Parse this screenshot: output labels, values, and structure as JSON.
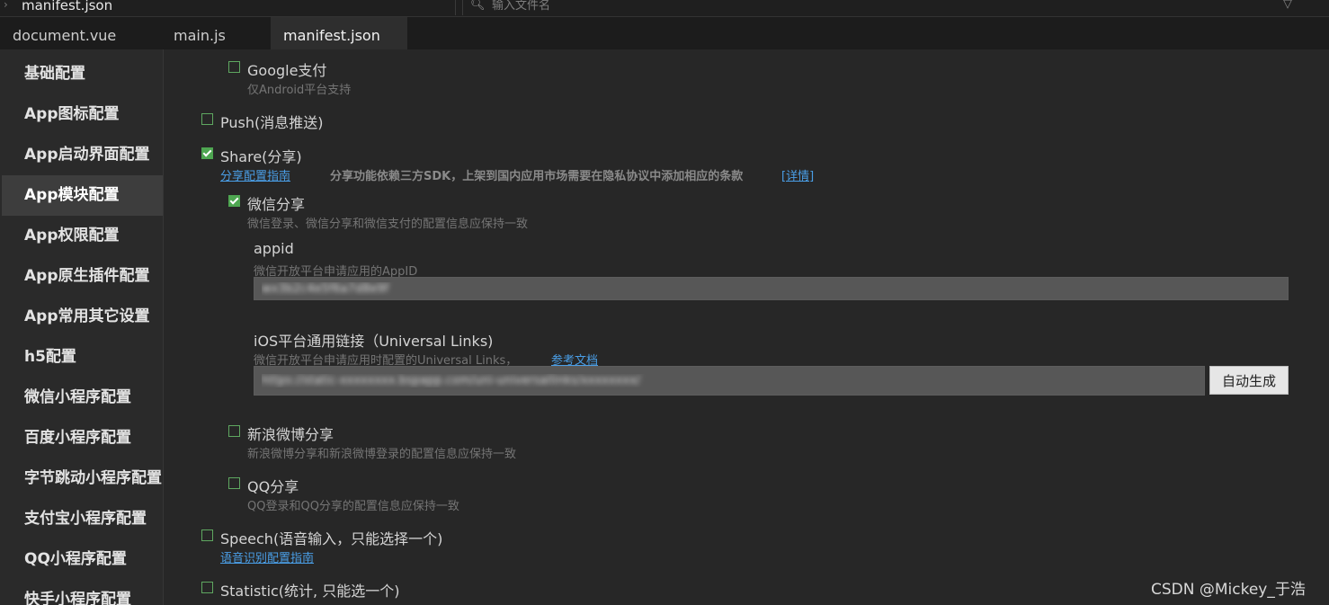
{
  "breadcrumb": {
    "file": "manifest.json"
  },
  "file_search": {
    "placeholder": "输入文件名"
  },
  "tabs": [
    {
      "label": "document.vue"
    },
    {
      "label": "main.js"
    },
    {
      "label": "manifest.json",
      "active": true
    }
  ],
  "sidebar": {
    "items": [
      {
        "label": "基础配置"
      },
      {
        "label": "App图标配置"
      },
      {
        "label": "App启动界面配置"
      },
      {
        "label": "App模块配置",
        "active": true
      },
      {
        "label": "App权限配置"
      },
      {
        "label": "App原生插件配置"
      },
      {
        "label": "App常用其它设置"
      },
      {
        "label": "h5配置"
      },
      {
        "label": "微信小程序配置"
      },
      {
        "label": "百度小程序配置"
      },
      {
        "label": "字节跳动小程序配置"
      },
      {
        "label": "支付宝小程序配置"
      },
      {
        "label": "QQ小程序配置"
      },
      {
        "label": "快手小程序配置"
      }
    ]
  },
  "main": {
    "google_pay": {
      "label": "Google支付",
      "checked": false,
      "desc": "仅Android平台支持"
    },
    "push": {
      "label": "Push(消息推送)",
      "checked": false
    },
    "share": {
      "label": "Share(分享)",
      "checked": true,
      "guide_link": "分享配置指南",
      "desc": "分享功能依赖三方SDK，上架到国内应用市场需要在隐私协议中添加相应的条款",
      "details_link": "[详情]"
    },
    "wechat": {
      "label": "微信分享",
      "checked": true,
      "desc": "微信登录、微信分享和微信支付的配置信息应保持一致"
    },
    "appid": {
      "label": "appid",
      "desc": "微信开放平台申请应用的AppID",
      "value": "wx3b2c4e5f6a7d8e9f"
    },
    "universal_links": {
      "label": "iOS平台通用链接（Universal Links)",
      "desc": "微信开放平台申请应用时配置的Universal Links，",
      "ref_link": "参考文档",
      "value": "https://static-xxxxxxxx.bspapp.com/uni-universallinks/xxxxxxxx/",
      "button": "自动生成"
    },
    "weibo": {
      "label": "新浪微博分享",
      "checked": false,
      "desc": "新浪微博分享和新浪微博登录的配置信息应保持一致"
    },
    "qq": {
      "label": "QQ分享",
      "checked": false,
      "desc": "QQ登录和QQ分享的配置信息应保持一致"
    },
    "speech": {
      "label": "Speech(语音输入，只能选择一个)",
      "checked": false,
      "guide_link": "语音识别配置指南"
    },
    "statistic": {
      "label": "Statistic(统计, 只能选一个)",
      "checked": false
    }
  },
  "watermark": "CSDN @Mickey_于浩"
}
